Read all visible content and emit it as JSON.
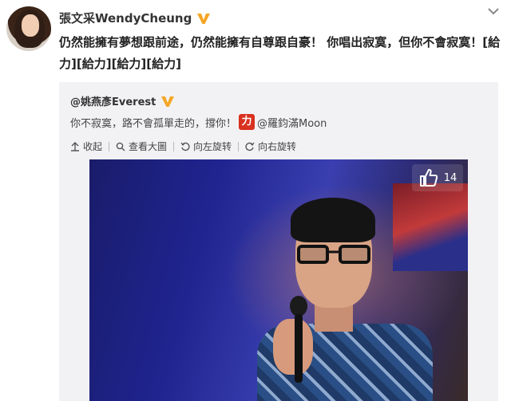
{
  "post": {
    "username": "張文采WendyCheung",
    "text": "仍然能擁有夢想跟前途，仍然能擁有自尊跟自豪！ 你唱出寂寞，但你不會寂寞！[給力][給力][給力][給力]"
  },
  "repost": {
    "author": "@姚燕彥Everest",
    "text_before": "你不寂寞，路不會孤單走的，撐你！",
    "force_icon": "力",
    "mention": "@羅鈞滿Moon",
    "actions": {
      "collapse": "收起",
      "view_large": "查看大圖",
      "rotate_left": "向左旋转",
      "rotate_right": "向右旋转"
    },
    "photo": {
      "like_count": "14"
    }
  },
  "icons": {
    "verified": "verified-v-icon",
    "menu": "chevron-down-icon",
    "thumbs_up": "thumbs-up-icon"
  },
  "colors": {
    "verified": "#f5a623",
    "force_icon_bg": "#d9311f",
    "repost_bg": "#f2f2f5"
  }
}
